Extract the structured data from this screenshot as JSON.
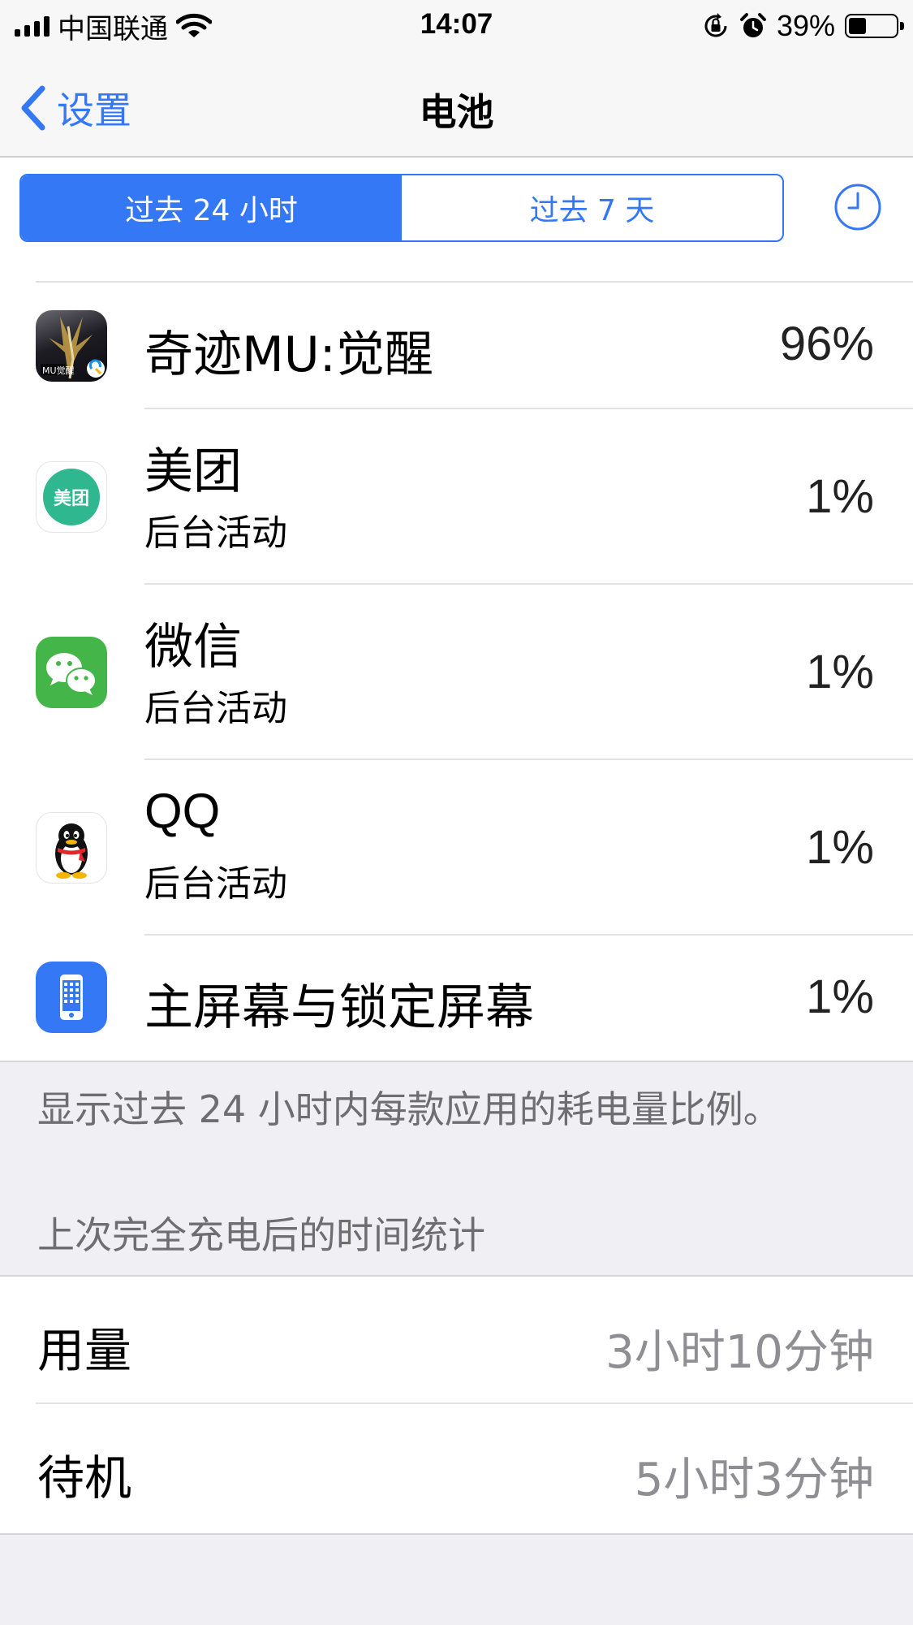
{
  "status_bar": {
    "carrier": "中国联通",
    "time": "14:07",
    "battery_percent": "39%",
    "battery_level": 0.39
  },
  "nav": {
    "back_label": "设置",
    "title": "电池"
  },
  "segment": {
    "options": [
      "过去 24 小时",
      "过去 7 天"
    ],
    "selected_index": 0
  },
  "apps": [
    {
      "name": "奇迹MU:觉醒",
      "subtitle": "",
      "percent": "96%",
      "icon": "game-app-icon"
    },
    {
      "name": "美团",
      "subtitle": "后台活动",
      "percent": "1%",
      "icon": "meituan-app-icon",
      "icon_text": "美团"
    },
    {
      "name": "微信",
      "subtitle": "后台活动",
      "percent": "1%",
      "icon": "wechat-app-icon"
    },
    {
      "name": "QQ",
      "subtitle": "后台活动",
      "percent": "1%",
      "icon": "qq-app-icon"
    },
    {
      "name": "主屏幕与锁定屏幕",
      "subtitle": "",
      "percent": "1%",
      "icon": "homescreen-icon"
    }
  ],
  "footer_note": "显示过去 24 小时内每款应用的耗电量比例。",
  "section_header": "上次完全充电后的时间统计",
  "stats": [
    {
      "label": "用量",
      "value": "3小时10分钟"
    },
    {
      "label": "待机",
      "value": "5小时3分钟"
    }
  ],
  "colors": {
    "accent": "#3478f6",
    "group_background": "#efeff4",
    "secondary_text": "#8e8e93",
    "meituan_green": "#2fb88f",
    "wechat_green": "#44b549"
  }
}
